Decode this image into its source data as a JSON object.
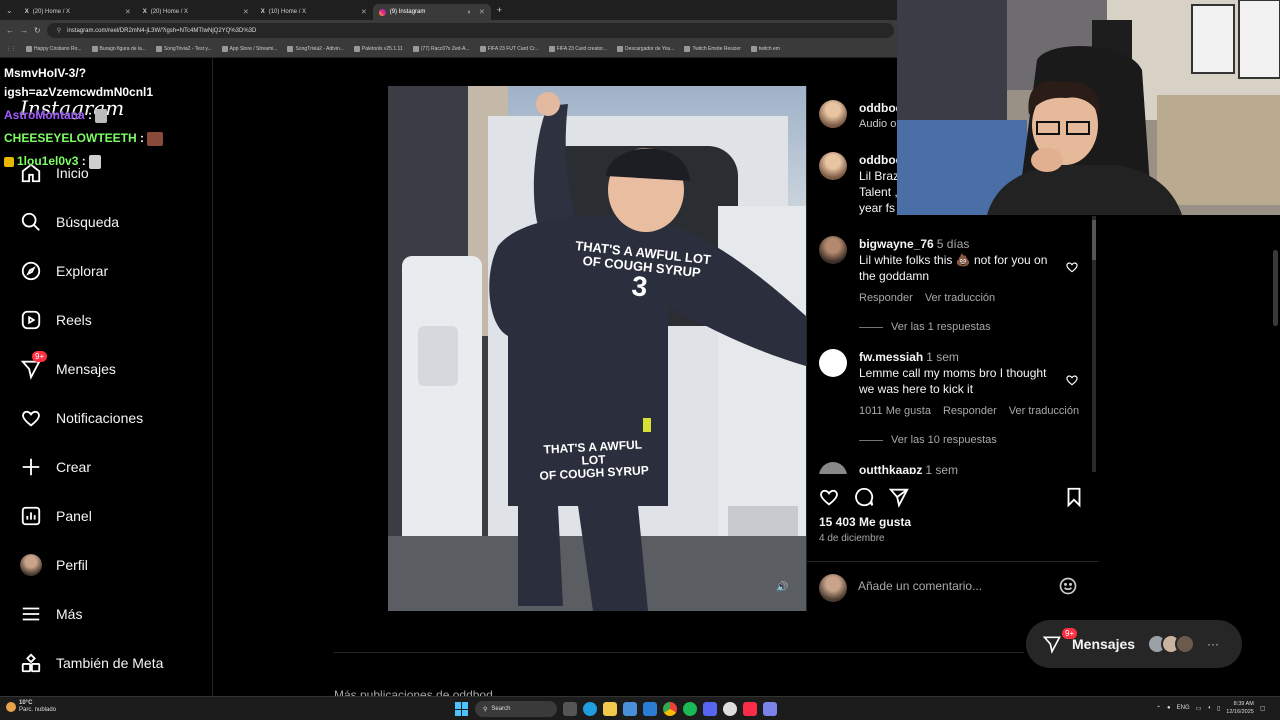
{
  "browser": {
    "tabs": [
      {
        "label": "(20) Home / X",
        "active": false
      },
      {
        "label": "(20) Home / X",
        "active": false
      },
      {
        "label": "(10) Home / X",
        "active": false
      },
      {
        "label": "(9) Instagram",
        "active": true
      }
    ],
    "url": "instagram.com/reel/DR2mN4-jL3W/?igsh=NTc4MTIwNjQ2YQ%3D%3D",
    "bookmarks": [
      "Happy Cristiano Ro...",
      "Burago figura de la...",
      "SongTrivia2 - Test y...",
      "App Store / Streami...",
      "SongTrivia2 - Adivin...",
      "Paletools v25.1.11",
      "(77) Racc0?s Zed-A...",
      "FIFA 23 FUT Card Cr...",
      "FIFA 23 Card creator...",
      "Descargador de You...",
      "Twitch Emote Resizer",
      "twitch em"
    ]
  },
  "chat": {
    "line1": "MsmvHoIV-3/?",
    "line2": "igsh=azVzemcwdmN0cnl1",
    "user1": "AstroMontana",
    "user2": "CHEESEYELOWTEETH",
    "user3": "1lou1el0v3"
  },
  "sidebar": {
    "logo": "Instagram",
    "items": [
      {
        "label": "Inicio"
      },
      {
        "label": "Búsqueda"
      },
      {
        "label": "Explorar"
      },
      {
        "label": "Reels"
      },
      {
        "label": "Mensajes",
        "badge": "9+"
      },
      {
        "label": "Notificaciones"
      },
      {
        "label": "Crear"
      },
      {
        "label": "Panel"
      },
      {
        "label": "Perfil"
      },
      {
        "label": "Más"
      },
      {
        "label": "También de Meta"
      }
    ]
  },
  "reel": {
    "shirt_text_1": "THAT'S A AWFUL LOT",
    "shirt_text_2": "OF COUGH SYRUP",
    "shirt_number": "3",
    "pants_text_1": "THAT'S A AWFUL LOT",
    "pants_text_2": "OF COUGH SYRUP"
  },
  "panel": {
    "author": "oddbod",
    "audio": "Audio or",
    "caption_user": "oddbod",
    "caption_l1": "Lil Brazz",
    "caption_l2": "Talent , F",
    "caption_l3": "year fs #",
    "comments": [
      {
        "user": "bigwayne_76",
        "time": "5 días",
        "text_l1": "Lil white folks this 💩 not for you on",
        "text_l2": "the goddamn",
        "likes": "",
        "reply": "Responder",
        "translate": "Ver traducción",
        "replies": "Ver las 1 respuestas"
      },
      {
        "user": "fw.messiah",
        "time": "1 sem",
        "text_l1": "Lemme call my moms bro I thought",
        "text_l2": "we was here to kick it",
        "likes": "1011 Me gusta",
        "reply": "Responder",
        "translate": "Ver traducción",
        "replies": "Ver las 10 respuestas"
      },
      {
        "user": "outthkaapz",
        "time": "1 sem"
      }
    ],
    "likes": "15 403 Me gusta",
    "date": "4 de diciembre",
    "comment_placeholder": "Añade un comentario..."
  },
  "messages_pill": {
    "label": "Mensajes",
    "badge": "9+"
  },
  "more_from": "Más publicaciones de oddbod",
  "taskbar": {
    "weather_temp": "10°C",
    "weather_desc": "Parc. nublado",
    "search": "Search",
    "lang": "ENG",
    "time": "8:39 AM",
    "date": "12/16/2025"
  },
  "colors": {
    "accent_badge": "#ff3040",
    "chat_purple": "#a35cff",
    "chat_green": "#7dff63",
    "background": "#000000"
  }
}
